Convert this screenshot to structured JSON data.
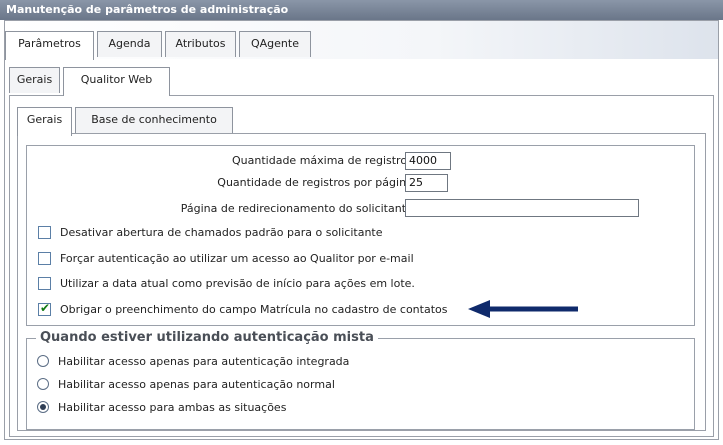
{
  "window": {
    "title": "Manutenção de parâmetros de administração"
  },
  "main_tabs": [
    {
      "label": "Parâmetros",
      "active": true
    },
    {
      "label": "Agenda",
      "active": false
    },
    {
      "label": "Atributos",
      "active": false
    },
    {
      "label": "QAgente",
      "active": false
    }
  ],
  "sub_tabs": [
    {
      "label": "Gerais",
      "active": false
    },
    {
      "label": "Qualitor Web",
      "active": true
    }
  ],
  "inner_tabs": [
    {
      "label": "Gerais",
      "active": true
    },
    {
      "label": "Base de conhecimento",
      "active": false
    }
  ],
  "fields": {
    "max_records": {
      "label": "Quantidade máxima de registros :",
      "value": "4000"
    },
    "records_per_page": {
      "label": "Quantidade de registros por página :",
      "value": "25"
    },
    "redirect_page": {
      "label": "Página de redirecionamento do solicitante :",
      "value": ""
    }
  },
  "checkboxes": [
    {
      "label": "Desativar abertura de chamados padrão para o solicitante",
      "checked": false
    },
    {
      "label": "Forçar autenticação ao utilizar um acesso ao Qualitor por e-mail",
      "checked": false
    },
    {
      "label": "Utilizar a data atual como previsão de início para ações em lote.",
      "checked": false
    },
    {
      "label": "Obrigar o preenchimento do campo Matrícula no cadastro de contatos",
      "checked": true
    }
  ],
  "auth_group": {
    "legend": "Quando estiver utilizando autenticação mista",
    "options": [
      {
        "label": "Habilitar acesso apenas para autenticação integrada",
        "selected": false
      },
      {
        "label": "Habilitar acesso apenas para autenticação normal",
        "selected": false
      },
      {
        "label": "Habilitar acesso para ambas as situações",
        "selected": true
      }
    ]
  },
  "colors": {
    "arrow": "#0f2a6b",
    "titlebar": "#7a8698",
    "check": "#127a12"
  },
  "icons": {
    "pointer": "left-arrow-icon",
    "check": "checkmark-icon"
  }
}
